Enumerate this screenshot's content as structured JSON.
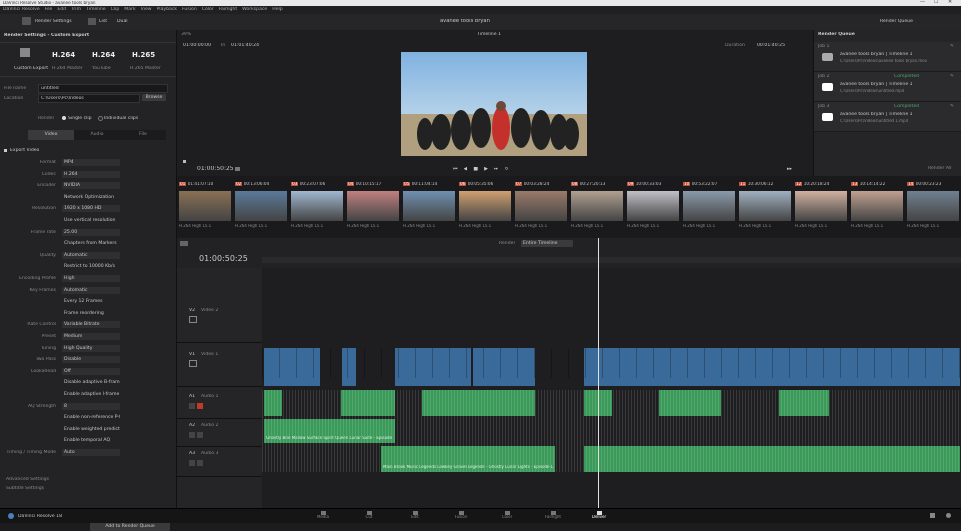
{
  "window": {
    "title": "DaVinci Resolve Studio - avanee tools bryan",
    "controls": [
      "—",
      "☐",
      "✕"
    ]
  },
  "menu": [
    "DaVinci Resolve",
    "File",
    "Edit",
    "Trim",
    "Timeline",
    "Clip",
    "Mark",
    "View",
    "Playback",
    "Fusion",
    "Color",
    "Fairlight",
    "Workspace",
    "Help"
  ],
  "toolbar": {
    "render_settings": "Render Settings",
    "list": "List",
    "dual_label": "Dual",
    "project_title": "avanee tools bryan",
    "timeline_name": "Timeline 1",
    "render_queue": "Render Queue"
  },
  "left": {
    "header": "Render Settings - Custom Export",
    "presets": [
      {
        "label": "Custom Export",
        "codec": ""
      },
      {
        "label": "H.264",
        "codec": "H.264 Master"
      },
      {
        "label": "H.264",
        "codec": "YouTube"
      },
      {
        "label": "H.265",
        "codec": "H.265 Master"
      }
    ],
    "filename_label": "File name",
    "filename_value": "untitled",
    "location_label": "Location",
    "location_value": "C:\\Users\\Pc\\Videos",
    "browse": "Browse",
    "render_label": "Render",
    "single_clip": "Single clip",
    "individual_clips": "Individual clips",
    "tabs": [
      "Video",
      "Audio",
      "File"
    ],
    "export_video": "Export Video",
    "rows": [
      {
        "l": "Format",
        "v": "MP4"
      },
      {
        "l": "Codec",
        "v": "H.264"
      },
      {
        "l": "Encoder",
        "v": "NVIDIA"
      },
      {
        "l": "",
        "v": "Network Optimization"
      },
      {
        "l": "Resolution",
        "v": "1920 x 1080 HD"
      },
      {
        "l": "",
        "v": "Use vertical resolution"
      },
      {
        "l": "Frame rate",
        "v": "25.00"
      },
      {
        "l": "",
        "v": "Chapters from Markers"
      },
      {
        "l": "Quality",
        "v": "Automatic"
      },
      {
        "l": "",
        "v": "Restrict to 10000 Kb/s"
      },
      {
        "l": "Encoding Profile",
        "v": "High"
      },
      {
        "l": "Key Frames",
        "v": "Automatic"
      },
      {
        "l": "",
        "v": "Every 12 Frames"
      },
      {
        "l": "",
        "v": "Frame reordering"
      },
      {
        "l": "Rate Control",
        "v": "Variable Bitrate"
      },
      {
        "l": "Preset",
        "v": "Medium"
      },
      {
        "l": "Tuning",
        "v": "High Quality"
      },
      {
        "l": "Two Pass",
        "v": "Disable"
      },
      {
        "l": "Lookahead",
        "v": "Off"
      },
      {
        "l": "",
        "v": "Disable adaptive B-frames"
      },
      {
        "l": "",
        "v": "Enable adaptive I-frame"
      },
      {
        "l": "AQ Strength",
        "v": "8"
      },
      {
        "l": "",
        "v": "Enable non-reference P-frame"
      },
      {
        "l": "",
        "v": "Enable weighted prediction"
      },
      {
        "l": "",
        "v": "Enable temporal AQ"
      },
      {
        "l": "Timing / Timing Mode",
        "v": "Auto"
      }
    ],
    "advanced": "Advanced Settings",
    "subtitle": "Subtitle Settings",
    "add_queue": "Add to Render Queue"
  },
  "viewer": {
    "zoom": "39%",
    "timecode_in": "01:00:00:00",
    "timecode_label": "In",
    "timecode_out": "01:01:40:24",
    "timeline_label": "Timeline 1",
    "duration_label": "Duration",
    "duration": "00:01:40:25",
    "main_tc": "01:00:50:25"
  },
  "queue": {
    "title": "Render Queue",
    "jobs": [
      {
        "id": "Job 1",
        "name": "avanee tools bryan | Timeline 1",
        "path": "C:\\Users\\Pc\\Videos\\avanee tools bryan.mov",
        "status": ""
      },
      {
        "id": "Job 2",
        "name": "avanee tools bryan | Timeline 1",
        "path": "C:\\Users\\Pc\\Videos\\untitled.mp4",
        "status": "Completed"
      },
      {
        "id": "Job 3",
        "name": "avanee tools bryan | Timeline 1",
        "path": "C:\\Users\\Pc\\Videos\\untitled 1.mp4",
        "status": "Completed"
      }
    ],
    "render_all": "Render All"
  },
  "strip": {
    "clips": [
      {
        "n": "01",
        "tc": "01:41:07:10"
      },
      {
        "n": "02",
        "tc": "00:13:06:04"
      },
      {
        "n": "03",
        "tc": "00:23:07:06"
      },
      {
        "n": "04",
        "tc": "00:10:15:17"
      },
      {
        "n": "05",
        "tc": "00:11:04:14"
      },
      {
        "n": "06",
        "tc": "00:05:35:06"
      },
      {
        "n": "07",
        "tc": "00:03:28:24"
      },
      {
        "n": "08",
        "tc": "00:27:20:13"
      },
      {
        "n": "09",
        "tc": "10:00:33:03"
      },
      {
        "n": "10",
        "tc": "00:53:22:07"
      },
      {
        "n": "11",
        "tc": "10:30:06:12"
      },
      {
        "n": "12",
        "tc": "10:20:18:24"
      },
      {
        "n": "13",
        "tc": "10:14:14:22"
      },
      {
        "n": "14",
        "tc": "00:00:23:23"
      }
    ],
    "codec": "H.264 High L5.1"
  },
  "timeline": {
    "tc": "01:00:50:25",
    "render_label": "Render",
    "render_value": "Entire Timeline",
    "tracks": [
      {
        "name": "V2",
        "label": "Video 2"
      },
      {
        "name": "V1",
        "label": "Video 1"
      },
      {
        "name": "A1",
        "label": "Audio 1"
      },
      {
        "name": "A2",
        "label": "Audio 2"
      },
      {
        "name": "A3",
        "label": "Audio 3"
      }
    ],
    "audio_caption_a2": "Ghostly Brie Mallow Surface Spirit Queen Lunar Suite - Episode 1",
    "audio_caption_a3": "Main Brook Music Legends Lowkey Gravel Legends - Ghostly Lunar Lights - Episode Lunar Brook"
  },
  "pages": [
    "Media",
    "Cut",
    "Edit",
    "Fusion",
    "Color",
    "Fairlight",
    "Deliver"
  ],
  "app_name": "DaVinci Resolve 18",
  "colors": {
    "accent": "#d44a3a",
    "video_clip": "#3a6a9a",
    "audio_clip": "#3a9a5a",
    "playhead": "#e0e0e0"
  }
}
